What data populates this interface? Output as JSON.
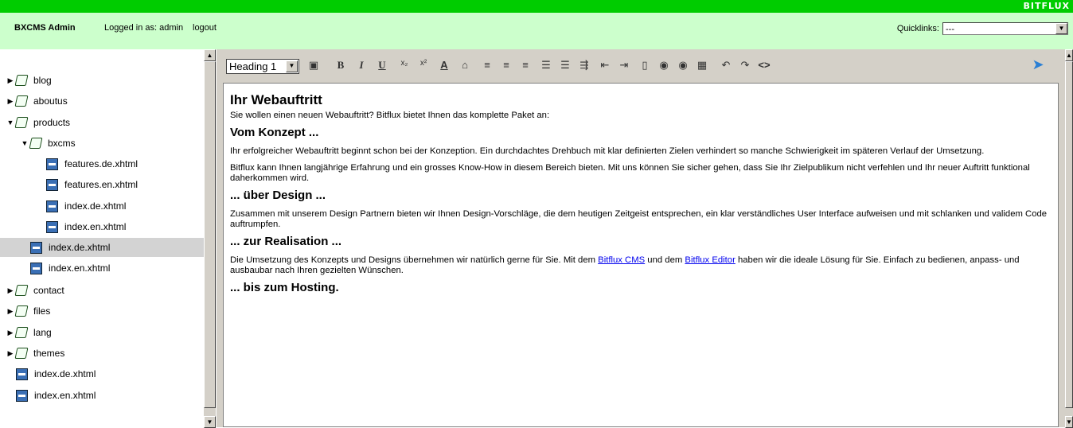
{
  "header": {
    "brand": "BITFLUX"
  },
  "adminbar": {
    "title": "BXCMS Admin",
    "logged_in": "Logged in as: admin",
    "logout": "logout",
    "quicklinks_label": "Quicklinks:",
    "quicklinks_value": "---"
  },
  "tree": {
    "items": [
      {
        "label": "blog"
      },
      {
        "label": "aboutus"
      },
      {
        "label": "products"
      },
      {
        "label": "bxcms"
      },
      {
        "label": "features.de.xhtml"
      },
      {
        "label": "features.en.xhtml"
      },
      {
        "label": "index.de.xhtml"
      },
      {
        "label": "index.en.xhtml"
      },
      {
        "label": "index.de.xhtml"
      },
      {
        "label": "index.en.xhtml"
      },
      {
        "label": "contact"
      },
      {
        "label": "files"
      },
      {
        "label": "lang"
      },
      {
        "label": "themes"
      },
      {
        "label": "index.de.xhtml"
      },
      {
        "label": "index.en.xhtml"
      }
    ]
  },
  "toolbar": {
    "block_format": "Heading 1",
    "icons": [
      "save-icon",
      "bold-icon",
      "italic-icon",
      "underline-icon",
      "subscript-icon",
      "superscript-icon",
      "text-color-icon",
      "highlight-icon",
      "align-left-icon",
      "align-center-icon",
      "align-right-icon",
      "ordered-list-icon",
      "unordered-list-icon",
      "indent-icon",
      "outdent-icon",
      "outdent2-icon",
      "page-icon",
      "link-icon",
      "unlink-icon",
      "table-icon",
      "undo-icon",
      "redo-icon",
      "source-icon"
    ],
    "glyphs": {
      "bold": "B",
      "italic": "I",
      "underline": "U",
      "subscript": "x₂",
      "superscript": "x²",
      "text_color": "A",
      "source": "<>"
    }
  },
  "document": {
    "h1": "Ihr Webauftritt",
    "intro": "Sie wollen einen neuen Webauftritt? Bitflux bietet Ihnen das komplette Paket an:",
    "h2_konzept": "Vom Konzept ...",
    "p_konzept1": "Ihr erfolgreicher Webauftritt beginnt schon bei der Konzeption. Ein durchdachtes Drehbuch mit klar definierten Zielen verhindert so manche Schwierigkeit im späteren Verlauf der Umsetzung.",
    "p_konzept2": "Bitflux kann Ihnen langjährige Erfahrung und ein grosses Know-How in diesem Bereich bieten. Mit uns können Sie sicher gehen, dass Sie Ihr Zielpublikum nicht verfehlen und Ihr neuer Auftritt funktional daherkommen wird.",
    "h2_design": "... über Design ...",
    "p_design": "Zusammen mit unserem Design Partnern bieten wir Ihnen Design-Vorschläge, die dem heutigen Zeitgeist entsprechen, ein klar verständliches User Interface aufweisen und mit schlanken und validem Code auftrumpfen.",
    "h2_real": "... zur Realisation ...",
    "p_real_a": "Die Umsetzung des Konzepts und Designs übernehmen wir natürlich gerne für Sie. Mit dem ",
    "link_cms": "Bitflux CMS",
    "p_real_b": " und dem ",
    "link_editor": "Bitflux Editor",
    "p_real_c": " haben wir die ideale Lösung für Sie. Einfach zu bedienen, anpass- und ausbaubar nach Ihren gezielten Wünschen.",
    "h2_host": "... bis zum Hosting."
  }
}
